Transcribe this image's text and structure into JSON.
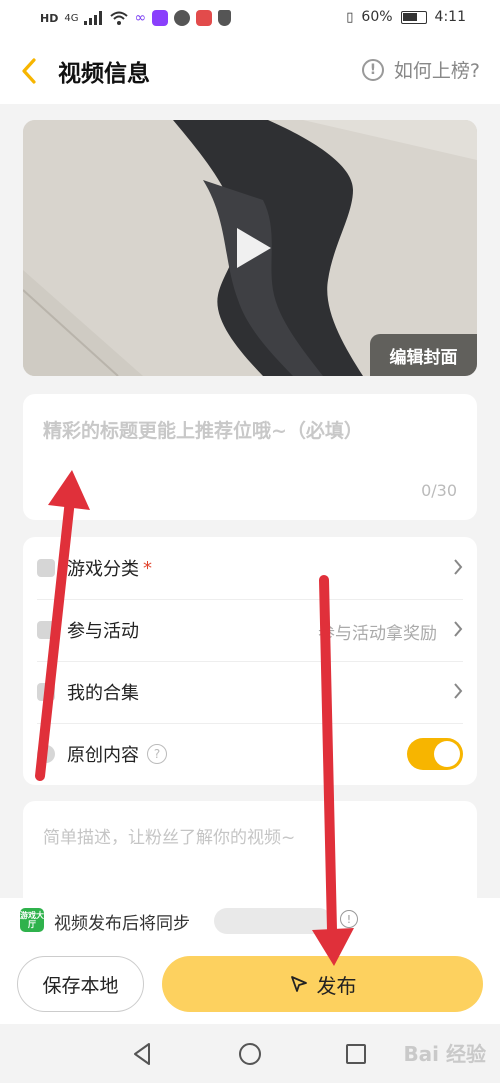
{
  "status_bar": {
    "network": "4G",
    "hd": "HD",
    "battery": "60%",
    "time": "4:11",
    "app_colors": [
      "#8a3ffc",
      "#e24b4b"
    ]
  },
  "header": {
    "back_icon": "chevron-left-icon",
    "title": "视频信息",
    "help_label": "如何上榜?",
    "help_icon": "!"
  },
  "video": {
    "edit_cover_label": "编辑封面",
    "play_icon": "play-icon"
  },
  "title_field": {
    "placeholder": "精彩的标题更能上推荐位哦~（必填）",
    "counter": "0/30"
  },
  "settings": [
    {
      "label": "游戏分类",
      "required_mark": "*",
      "hint": ""
    },
    {
      "label": "参与活动",
      "hint": "参与活动拿奖励"
    },
    {
      "label": "我的合集",
      "hint": ""
    },
    {
      "label": "原创内容",
      "info": "?",
      "toggle_on": true
    }
  ],
  "description": {
    "placeholder": "简单描述，让粉丝了解你的视频~"
  },
  "sync": {
    "logo_text": "游戏大厅",
    "text": "视频发布后将同步",
    "info": "!"
  },
  "buttons": {
    "save_label": "保存本地",
    "publish_label": "发布"
  },
  "navbar": {
    "watermark": "Bai 经验"
  },
  "colors": {
    "accent": "#f7b500",
    "publish": "#fdd15f",
    "arrow": "#e0303a"
  }
}
